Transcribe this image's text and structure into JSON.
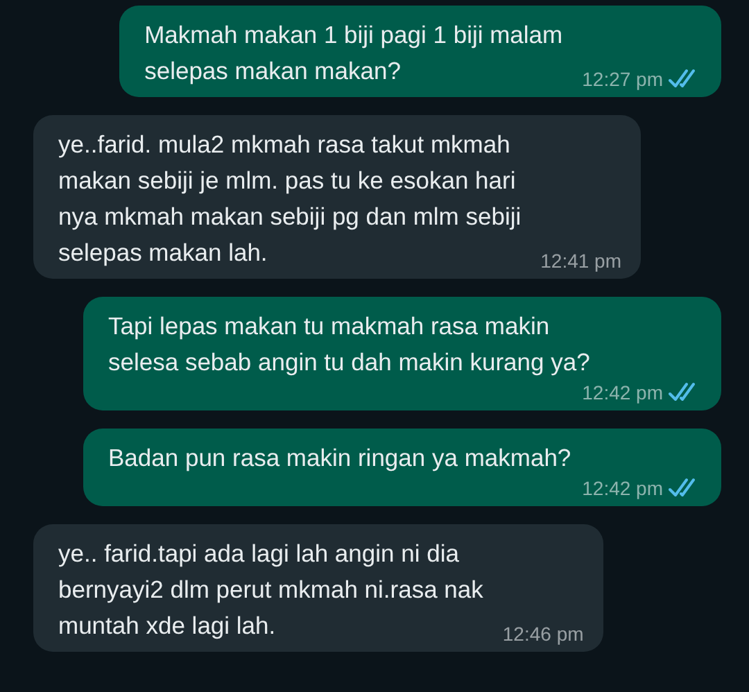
{
  "messages": [
    {
      "kind": "outgoing",
      "text": "Makmah makan 1 biji pagi 1 biji malam\nselepas makan makan?",
      "time": "12:27 pm",
      "read": true
    },
    {
      "kind": "incoming",
      "text": "ye..farid. mula2 mkmah rasa takut mkmah\nmakan sebiji je mlm. pas tu ke esokan hari\nnya mkmah makan sebiji pg dan mlm sebiji\nselepas makan lah.",
      "time": "12:41 pm"
    },
    {
      "kind": "outgoing",
      "text": "Tapi lepas makan tu makmah rasa makin\nselesa sebab angin tu dah makin kurang ya?",
      "time": "12:42 pm",
      "read": true
    },
    {
      "kind": "outgoing",
      "text": "Badan pun rasa makin ringan ya makmah?",
      "time": "12:42 pm",
      "read": true
    },
    {
      "kind": "incoming",
      "text": "ye.. farid.tapi ada lagi lah angin ni dia\nbernyayi2 dlm perut mkmah ni.rasa nak\nmuntah xde lagi lah.",
      "time": "12:46 pm"
    }
  ]
}
